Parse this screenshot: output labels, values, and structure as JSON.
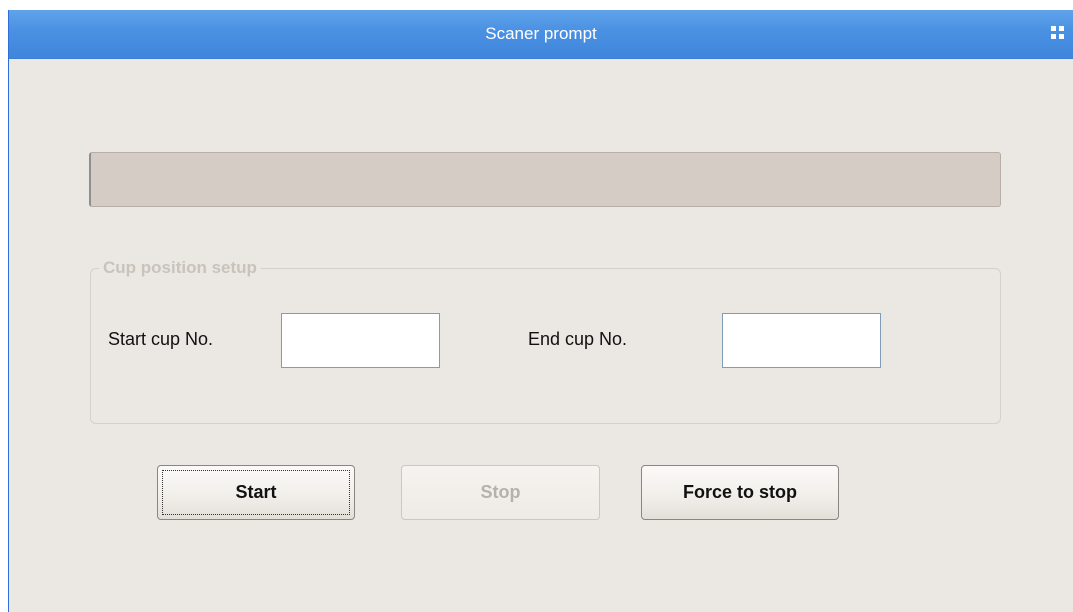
{
  "window": {
    "title": "Scaner prompt",
    "title_icon": "grid-icon"
  },
  "progress": {
    "value": 0
  },
  "group": {
    "legend": "Cup position setup",
    "start_label": "Start cup No.",
    "start_value": "",
    "end_label": "End cup No.",
    "end_value": ""
  },
  "buttons": {
    "start": "Start",
    "stop": "Stop",
    "force_stop": "Force to stop"
  },
  "colors": {
    "titlebar": "#4a90e2",
    "window_bg": "#ebe7e3",
    "progress_bg": "#d6ccc6"
  }
}
